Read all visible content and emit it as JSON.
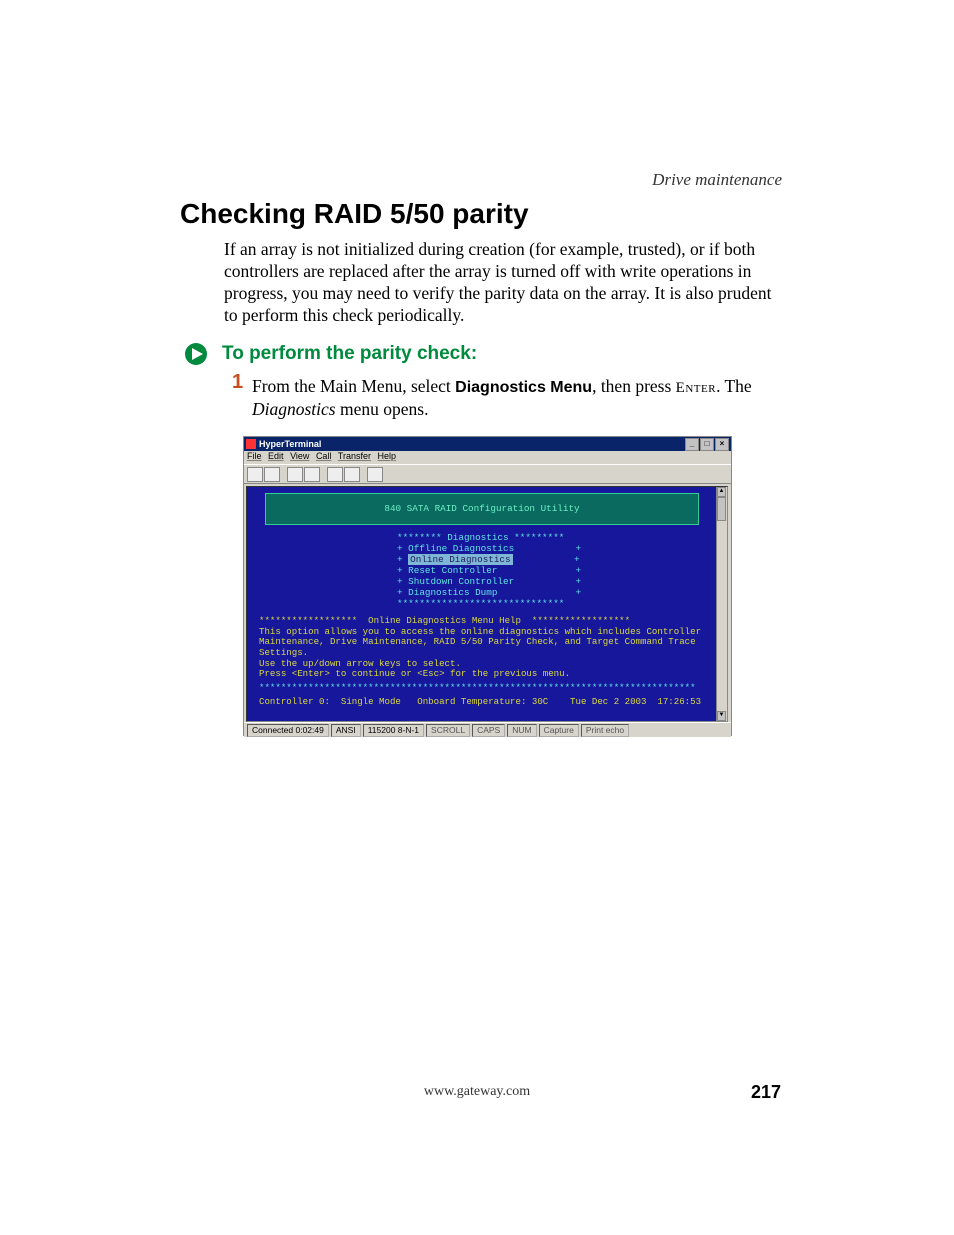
{
  "header": {
    "section": "Drive maintenance"
  },
  "title": "Checking RAID 5/50 parity",
  "intro": "If an array is not initialized during creation (for example, trusted), or if both controllers are replaced after the array is turned off with write operations in progress, you may need to verify the parity data on the array. It is also prudent to perform this check periodically.",
  "procedure": {
    "heading": "To perform the parity check:",
    "step_number": "1",
    "step_pre": "From the Main Menu, select ",
    "step_bold": "Diagnostics Menu",
    "step_mid": ", then press ",
    "step_enter": "Enter",
    "step_post1": ". The ",
    "step_ital": "Diagnostics",
    "step_post2": " menu opens."
  },
  "screenshot": {
    "window_title": "HyperTerminal",
    "menus": [
      "File",
      "Edit",
      "View",
      "Call",
      "Transfer",
      "Help"
    ],
    "banner": "840 SATA RAID Configuration Utility",
    "diag_header": "******** Diagnostics *********",
    "items": [
      "+ Offline Diagnostics           +",
      "+ ",
      "+ Reset Controller              +",
      "+ Shutdown Controller           +",
      "+ Diagnostics Dump              +"
    ],
    "selected_item": "Online Diagnostics",
    "selected_plus": "           +",
    "diag_footer": "******************************",
    "help_title": "******************  Online Diagnostics Menu Help  ******************",
    "help_body": "This option allows you to access the online diagnostics which includes Controller Maintenance, Drive Maintenance, RAID 5/50 Parity Check, and Target Command Trace Settings.\nUse the up/down arrow keys to select.\nPress <Enter> to continue or <Esc> for the previous menu.",
    "stars": "********************************************************************************",
    "status": "Controller 0:  Single Mode   Onboard Temperature: 30C    Tue Dec 2 2003  17:26:53",
    "ht_status": {
      "connected": "Connected 0:02:49",
      "emulation": "ANSI",
      "params": "115200 8-N-1",
      "scroll": "SCROLL",
      "caps": "CAPS",
      "num": "NUM",
      "capture": "Capture",
      "echo": "Print echo"
    }
  },
  "footer": {
    "url": "www.gateway.com",
    "page": "217"
  }
}
